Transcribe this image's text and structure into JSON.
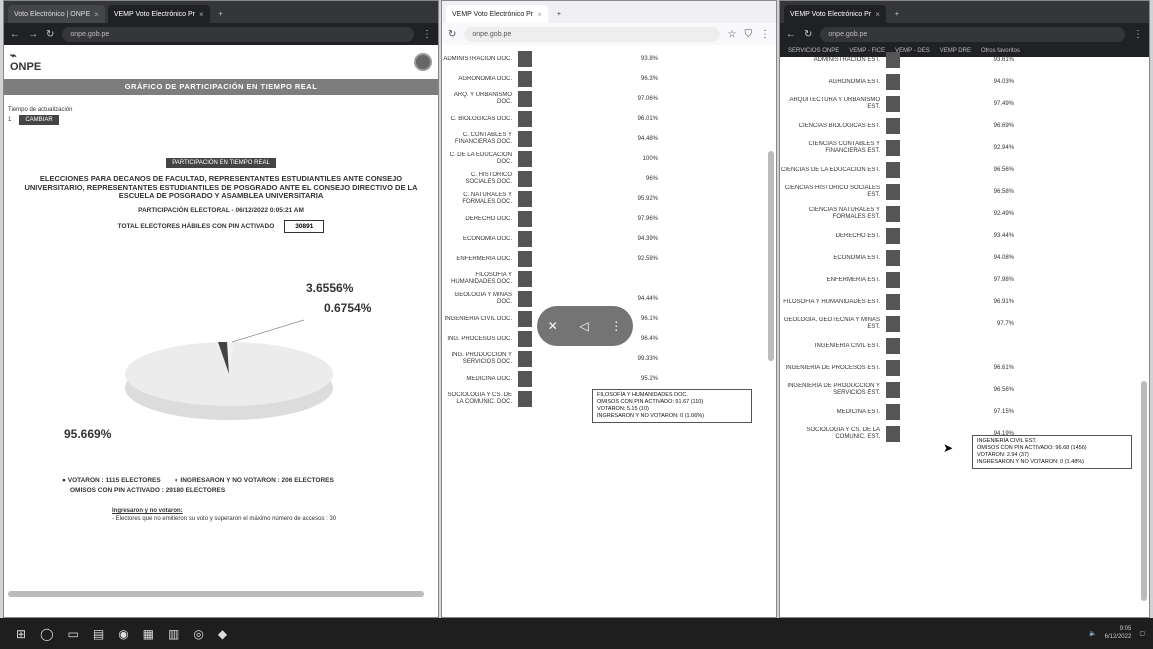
{
  "window1": {
    "tabs": [
      {
        "label": "Voto Electrónico | ONPE"
      },
      {
        "label": "VEMP Voto Electrónico Pr"
      }
    ],
    "url": "onpe.gob.pe",
    "logo_text": "ONPE",
    "banner": "GRÁFICO DE PARTICIPACIÓN EN TIEMPO REAL",
    "refresh_label": "Tiempo de actualización",
    "refresh_value": "1",
    "refresh_button": "CAMBIAR",
    "center_button": "PARTICIPACIÓN EN TIEMPO REAL",
    "title": "ELECCIONES PARA DECANOS DE FACULTAD, REPRESENTANTES ESTUDIANTILES ANTE CONSEJO UNIVERSITARIO, REPRESENTANTES ESTUDIANTILES DE POSGRADO ANTE EL CONSEJO DIRECTIVO DE LA ESCUELA DE POSGRADO Y ASAMBLEA UNIVERSITARIA",
    "participation_line": "PARTICIPACIÓN ELECTORAL - 06/12/2022 0:05:21 AM",
    "total_label": "TOTAL ELECTORES HÁBILES CON PIN ACTIVADO",
    "total_value": "30891",
    "pct_1": "3.6556%",
    "pct_2": "0.6754%",
    "pct_3": "95.669%",
    "legend_votaron": "VOTARON : 1115 ELECTORES",
    "legend_ingresaron": "INGRESARON Y NO VOTARON : 206 ELECTORES",
    "legend_omisos": "OMISOS CON PIN ACTIVADO : 29180 ELECTORES",
    "note_title": "Ingresaron y no votaron:",
    "note_text": "- Electores que no emitieron su voto y superaron el máximo número de accesos : 30"
  },
  "window2": {
    "tab_label": "VEMP Voto Electrónico Pr",
    "url": "onpe.gob.pe",
    "rows": [
      {
        "label": "ADMINISTRACIÓN DOC.",
        "value": "93.8%"
      },
      {
        "label": "AGRONOMÍA DOC.",
        "value": "96.3%"
      },
      {
        "label": "ARQ. Y URBANISMO DOC.",
        "value": "97.06%"
      },
      {
        "label": "C. BIOLÓGICAS DOC.",
        "value": "96.01%"
      },
      {
        "label": "C. CONTABLES Y FINANCIERAS DOC.",
        "value": "94.48%"
      },
      {
        "label": "C. DE LA EDUCACIÓN DOC.",
        "value": "100%"
      },
      {
        "label": "C. HISTÓRICO SOCIALES DOC.",
        "value": "96%"
      },
      {
        "label": "C. NATURALES Y FORMALES DOC.",
        "value": "95.92%"
      },
      {
        "label": "DERECHO DOC.",
        "value": "97.96%"
      },
      {
        "label": "ECONOMÍA DOC.",
        "value": "94.39%"
      },
      {
        "label": "ENFERMERÍA DOC.",
        "value": "92.58%"
      },
      {
        "label": "FILOSOFÍA Y HUMANIDADES DOC.",
        "value": ""
      },
      {
        "label": "GEOLOGÍA Y MINAS DOC.",
        "value": "94.44%"
      },
      {
        "label": "INGENIERÍA CIVIL DOC.",
        "value": "96.1%"
      },
      {
        "label": "ING. PROCESOS DOC.",
        "value": "96.4%"
      },
      {
        "label": "ING. PRODUCCIÓN Y SERVICIOS DOC.",
        "value": "99.33%"
      },
      {
        "label": "MEDICINA DOC.",
        "value": "95.2%"
      },
      {
        "label": "SOCIOLOGÍA Y CS. DE LA COMUNIC. DOC.",
        "value": "98.15%"
      }
    ],
    "tooltip": "FILOSOFÍA Y HUMANIDADES DOC.\nOMISOS CON PIN ACTIVADO: 91.67 (110)\nVOTARON: 5.15 (10)\nINGRESARON Y NO VOTARON: 0 (1.06%)"
  },
  "window3": {
    "tab_label": "VEMP Voto Electrónico Pr",
    "url": "onpe.gob.pe",
    "bookmarks": [
      "SERVICIOS ONPE",
      "VEMP - FICE",
      "VEMP - DES",
      "VEMP DRE",
      "Otros favoritos"
    ],
    "rows": [
      {
        "label": "ADMINISTRACIÓN EST.",
        "value": "93.61%"
      },
      {
        "label": "AGRONOMÍA EST.",
        "value": "94.03%"
      },
      {
        "label": "ARQUITECTURA Y URBANISMO EST.",
        "value": "97.49%"
      },
      {
        "label": "CIENCIAS BIOLÓGICAS EST.",
        "value": "96.69%"
      },
      {
        "label": "CIENCIAS CONTABLES Y FINANCIERAS EST.",
        "value": "92.94%"
      },
      {
        "label": "CIENCIAS DE LA EDUCACIÓN EST.",
        "value": "96.56%"
      },
      {
        "label": "CIENCIAS HISTÓRICO SOCIALES EST.",
        "value": "96.58%"
      },
      {
        "label": "CIENCIAS NATURALES Y FORMALES EST.",
        "value": "92.49%"
      },
      {
        "label": "DERECHO EST.",
        "value": "93.44%"
      },
      {
        "label": "ECONOMÍA EST.",
        "value": "94.08%"
      },
      {
        "label": "ENFERMERÍA EST.",
        "value": "97.98%"
      },
      {
        "label": "FILOSOFÍA Y HUMANIDADES EST.",
        "value": "96.91%"
      },
      {
        "label": "GEOLOGÍA, GEOTECNIA Y MINAS EST.",
        "value": "97.7%"
      },
      {
        "label": "INGENIERÍA CIVIL EST.",
        "value": ""
      },
      {
        "label": "INGENIERÍA DE PROCESOS EST.",
        "value": "96.61%"
      },
      {
        "label": "INGENIERÍA DE PRODUCCIÓN Y SERVICIOS EST.",
        "value": "96.56%"
      },
      {
        "label": "MEDICINA EST.",
        "value": "97.15%"
      },
      {
        "label": "SOCIOLOGÍA Y CS. DE LA COMUNIC. EST.",
        "value": "94.19%"
      }
    ],
    "tooltip": "INGENIERÍA CIVIL EST.\nOMISOS CON PIN ACTIVADO: 96.68 (1456)\nVOTARON: 2.94 (37)\nINGRESARON Y NO VOTARON: 0 (1.48%)"
  },
  "taskbar": {
    "time": "9:05",
    "date": "6/12/2022"
  }
}
